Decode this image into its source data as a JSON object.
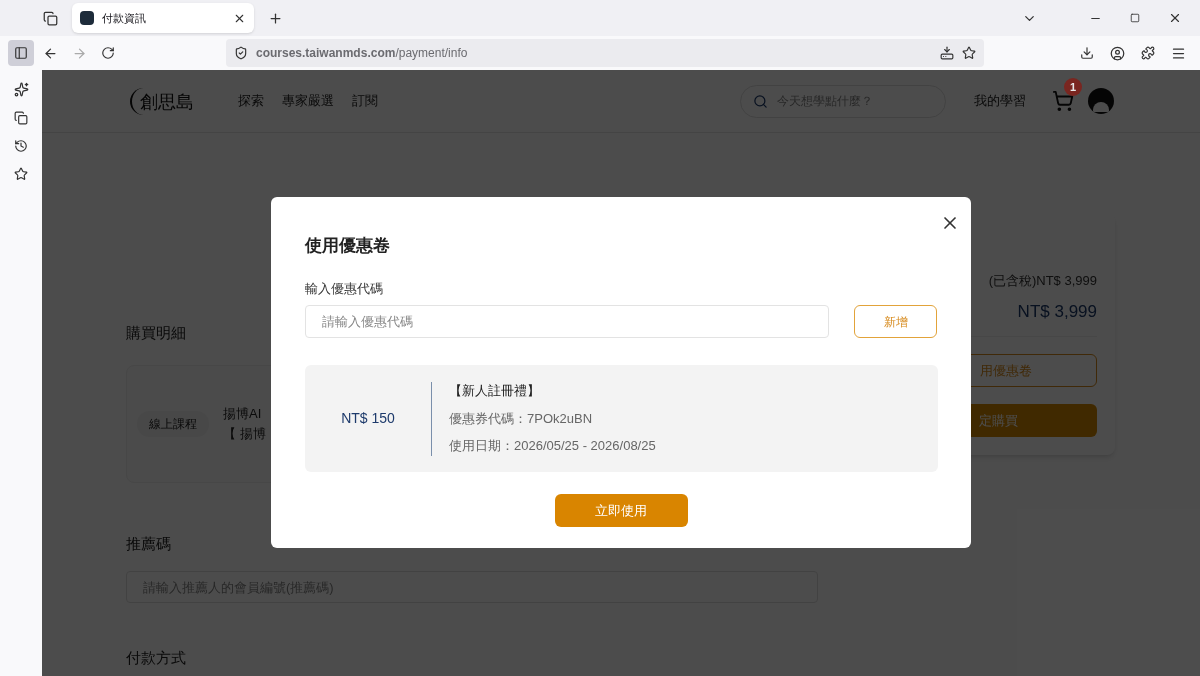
{
  "browser": {
    "tab": {
      "title": "付款資訊",
      "selected": true
    },
    "url": "**courses.taiwanmds.com**/payment/info"
  },
  "site_header": {
    "logo": "創思島",
    "nav": [
      "探索",
      "專家嚴選",
      "訂閱"
    ],
    "search": {
      "placeholder": "今天想學點什麼？"
    },
    "my_learning": "我的學習",
    "cart_count": "1"
  },
  "purchase": {
    "heading": "購買明細",
    "item": {
      "tag": "線上課程",
      "lines": [
        "揚博AI",
        "【 揚博"
      ]
    }
  },
  "referral": {
    "heading": "推薦碼",
    "placeholder": "請輸入推薦人的會員編號(推薦碼)"
  },
  "payment_heading": "付款方式",
  "summary": {
    "subtotal": "(已含稅)NT$ 3,999",
    "total": "NT$ 3,999",
    "buttons": [
      "用優惠卷",
      "定購買"
    ]
  },
  "modal": {
    "title": "使用優惠卷",
    "field_label": "輸入優惠代碼",
    "placeholder": "請輸入優惠代碼",
    "add_button": "新增",
    "coupons": [
      {
        "amount": "NT$ 150",
        "name": "【新人註冊禮】",
        "code": "優惠券代碼：7POk2uBN",
        "dates": "使用日期：2026/05/25 - 2026/08/25"
      }
    ],
    "apply_button": "立即使用"
  }
}
